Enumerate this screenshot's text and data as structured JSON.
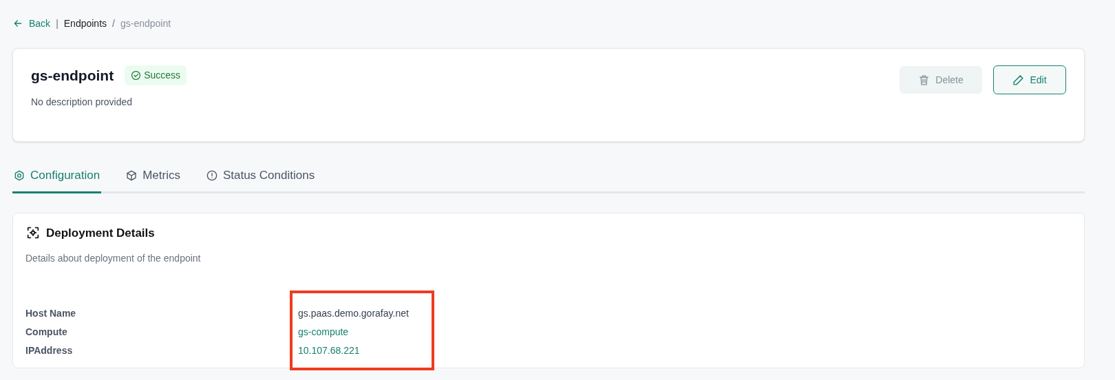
{
  "breadcrumb": {
    "back": "Back",
    "separator": "|",
    "items": [
      {
        "label": "Endpoints",
        "current": false
      },
      {
        "label": "gs-endpoint",
        "current": true
      }
    ],
    "divider": "/"
  },
  "header": {
    "title": "gs-endpoint",
    "status": "Success",
    "description": "No description provided",
    "buttons": [
      {
        "label": "Delete",
        "kind": "delete",
        "disabled": true
      },
      {
        "label": "Edit",
        "kind": "edit",
        "disabled": false
      }
    ]
  },
  "tabs": [
    {
      "label": "Configuration",
      "kind": "hexagon",
      "selected": true
    },
    {
      "label": "Metrics",
      "kind": "cube",
      "selected": false
    },
    {
      "label": "Status Conditions",
      "kind": "alert",
      "selected": false
    }
  ],
  "section": {
    "title": "Deployment Details",
    "subtitle": "Details about deployment of the endpoint",
    "rows": [
      {
        "label": "Host Name",
        "value": "gs.paas.demo.gorafay.net",
        "kind": "text"
      },
      {
        "label": "Compute",
        "value": "gs-compute",
        "kind": "link"
      },
      {
        "label": "IPAddress",
        "value": "10.107.68.221",
        "kind": "link"
      }
    ]
  }
}
